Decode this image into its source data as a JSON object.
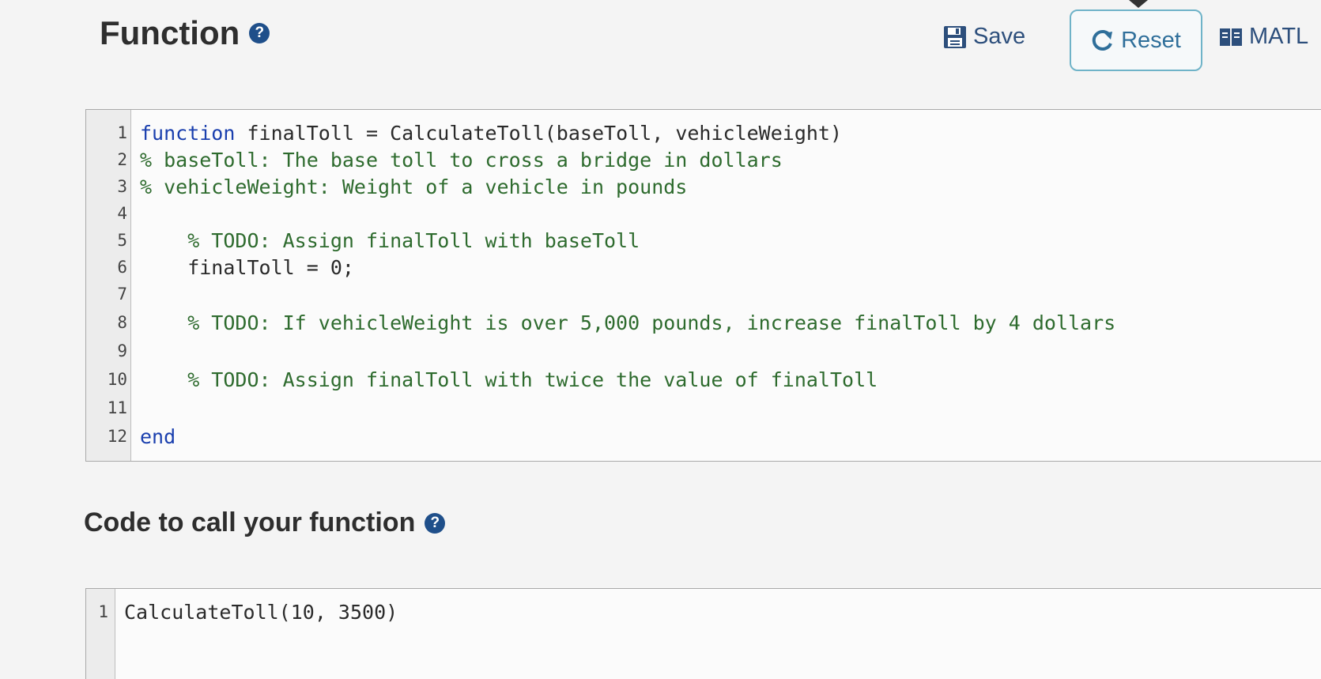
{
  "header": {
    "title": "Function",
    "save_label": "Save",
    "reset_label": "Reset",
    "matlab_label": "MATL"
  },
  "editor": {
    "lines": [
      {
        "num": "1",
        "text": "function",
        "rest": " finalToll = CalculateToll(baseToll, vehicleWeight)"
      },
      {
        "num": "2",
        "comment": "% baseToll: The base toll to cross a bridge in dollars"
      },
      {
        "num": "3",
        "comment": "% vehicleWeight: Weight of a vehicle in pounds"
      },
      {
        "num": "4"
      },
      {
        "num": "5",
        "comment": "    % TODO: Assign finalToll with baseToll"
      },
      {
        "num": "6",
        "rest": "    finalToll = 0;"
      },
      {
        "num": "7"
      },
      {
        "num": "8",
        "comment": "    % TODO: If vehicleWeight is over 5,000 pounds, increase finalToll by 4 dollars"
      },
      {
        "num": "9"
      },
      {
        "num": "10",
        "comment": "    % TODO: Assign finalToll with twice the value of finalToll"
      },
      {
        "num": "11"
      },
      {
        "num": "12",
        "text": "end"
      }
    ]
  },
  "call_section": {
    "title": "Code to call your function",
    "lines": [
      {
        "num": "1",
        "code": "CalculateToll(10, 3500)"
      }
    ]
  }
}
